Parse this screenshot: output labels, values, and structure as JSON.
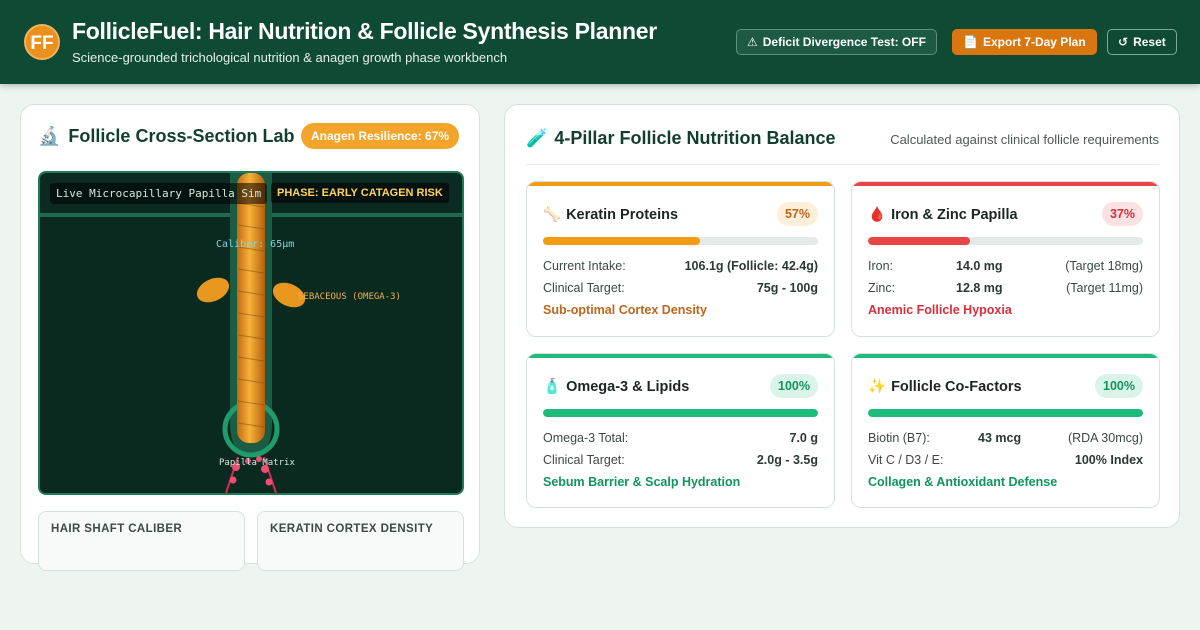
{
  "header": {
    "logo_text": "FF",
    "title": "FollicleFuel: Hair Nutrition & Follicle Synthesis Planner",
    "subtitle": "Science-grounded trichological nutrition & anagen growth phase workbench",
    "divergence_label": "Deficit Divergence Test: OFF",
    "divergence_icon": "⚠",
    "export_label": "Export 7-Day Plan",
    "export_icon": "📄",
    "reset_label": "Reset",
    "reset_icon": "↺"
  },
  "lab": {
    "icon": "🔬",
    "title": "Follicle Cross-Section Lab",
    "resilience": "Anagen Resilience: 67%",
    "sim_label": "Live Microcapillary Papilla Sim",
    "phase_label": "PHASE: EARLY CATAGEN RISK",
    "caliber_label": "Caliber: 65μm",
    "sebaceous_label": "SEBACEOUS (OMEGA-3)",
    "papilla_label": "Papilla Matrix",
    "cards": [
      {
        "label": "HAIR SHAFT CALIBER"
      },
      {
        "label": "KERATIN CORTEX DENSITY"
      }
    ]
  },
  "balance": {
    "icon": "🧪",
    "title": "4-Pillar Follicle Nutrition Balance",
    "note": "Calculated against clinical follicle requirements",
    "pillars": [
      {
        "icon": "🦴",
        "name": "Keratin Proteins",
        "percent_label": "57%",
        "percent": 57,
        "color": "#f39c12",
        "rows": [
          {
            "label": "Current Intake:",
            "value": "106.1g (Follicle: 42.4g)"
          },
          {
            "label": "Clinical Target:",
            "value": "75g - 100g"
          }
        ],
        "status": "Sub-optimal Cortex Density",
        "status_color": "#c0661a"
      },
      {
        "icon": "🩸",
        "name": "Iron & Zinc Papilla",
        "percent_label": "37%",
        "percent": 37,
        "color": "#e84545",
        "rows": [
          {
            "label": "Iron:",
            "value": "14.0 mg",
            "ref": "(Target 18mg)"
          },
          {
            "label": "Zinc:",
            "value": "12.8 mg",
            "ref": "(Target 11mg)"
          }
        ],
        "status": "Anemic Follicle Hypoxia",
        "status_color": "#d8303a"
      },
      {
        "icon": "🧴",
        "name": "Omega-3 & Lipids",
        "percent_label": "100%",
        "percent": 100,
        "color": "#1ebc7c",
        "rows": [
          {
            "label": "Omega-3 Total:",
            "value": "7.0 g"
          },
          {
            "label": "Clinical Target:",
            "value": "2.0g - 3.5g"
          }
        ],
        "status": "Sebum Barrier & Scalp Hydration",
        "status_color": "#12945e"
      },
      {
        "icon": "✨",
        "name": "Follicle Co-Factors",
        "percent_label": "100%",
        "percent": 100,
        "color": "#1ebc7c",
        "rows": [
          {
            "label": "Biotin (B7):",
            "value": "43 mcg",
            "ref": "(RDA 30mcg)"
          },
          {
            "label": "Vit C / D3 / E:",
            "value": "100% Index"
          }
        ],
        "status": "Collagen & Antioxidant Defense",
        "status_color": "#12945e"
      }
    ]
  }
}
